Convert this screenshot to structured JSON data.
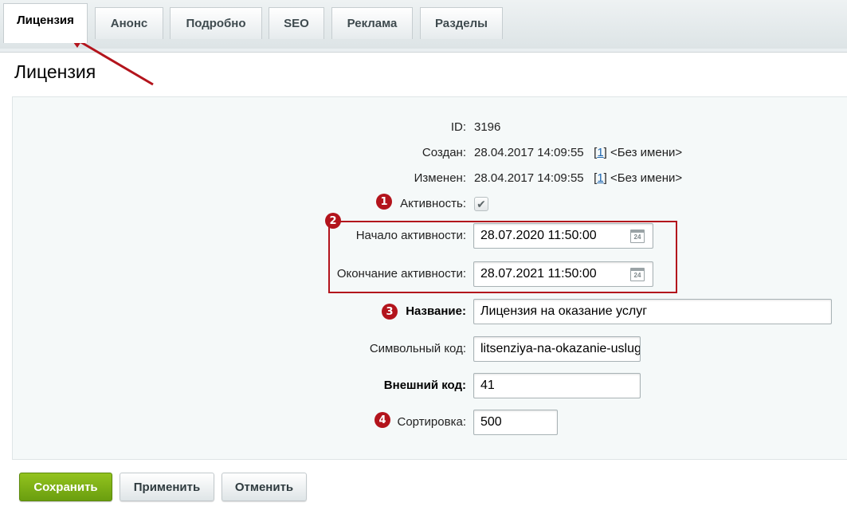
{
  "tabs": [
    {
      "label": "Лицензия",
      "active": true
    },
    {
      "label": "Анонс"
    },
    {
      "label": "Подробно"
    },
    {
      "label": "SEO"
    },
    {
      "label": "Реклама"
    },
    {
      "label": "Разделы"
    }
  ],
  "page_title": "Лицензия",
  "form": {
    "id": {
      "label": "ID:",
      "value": "3196"
    },
    "created": {
      "label": "Создан:",
      "datetime": "28.04.2017 14:09:55",
      "user_id": "1",
      "user_name": "<Без имени>"
    },
    "modified": {
      "label": "Изменен:",
      "datetime": "28.04.2017 14:09:55",
      "user_id": "1",
      "user_name": "<Без имени>"
    },
    "active": {
      "label": "Активность:",
      "checked": true
    },
    "active_from": {
      "label": "Начало активности:",
      "value": "28.07.2020 11:50:00"
    },
    "active_to": {
      "label": "Окончание активности:",
      "value": "28.07.2021 11:50:00"
    },
    "name": {
      "label": "Название:",
      "value": "Лицензия на оказание услуг"
    },
    "code": {
      "label": "Символьный код:",
      "value": "litsenziya-na-okazanie-uslug"
    },
    "external_id": {
      "label": "Внешний код:",
      "value": "41"
    },
    "sort": {
      "label": "Сортировка:",
      "value": "500"
    }
  },
  "calendar_day": "24",
  "annotations": {
    "b1": "1",
    "b2": "2",
    "b3": "3",
    "b4": "4"
  },
  "buttons": {
    "save": "Сохранить",
    "apply": "Применить",
    "cancel": "Отменить"
  },
  "colors": {
    "annotation_red": "#b3141c",
    "save_green": "#7cae14"
  }
}
